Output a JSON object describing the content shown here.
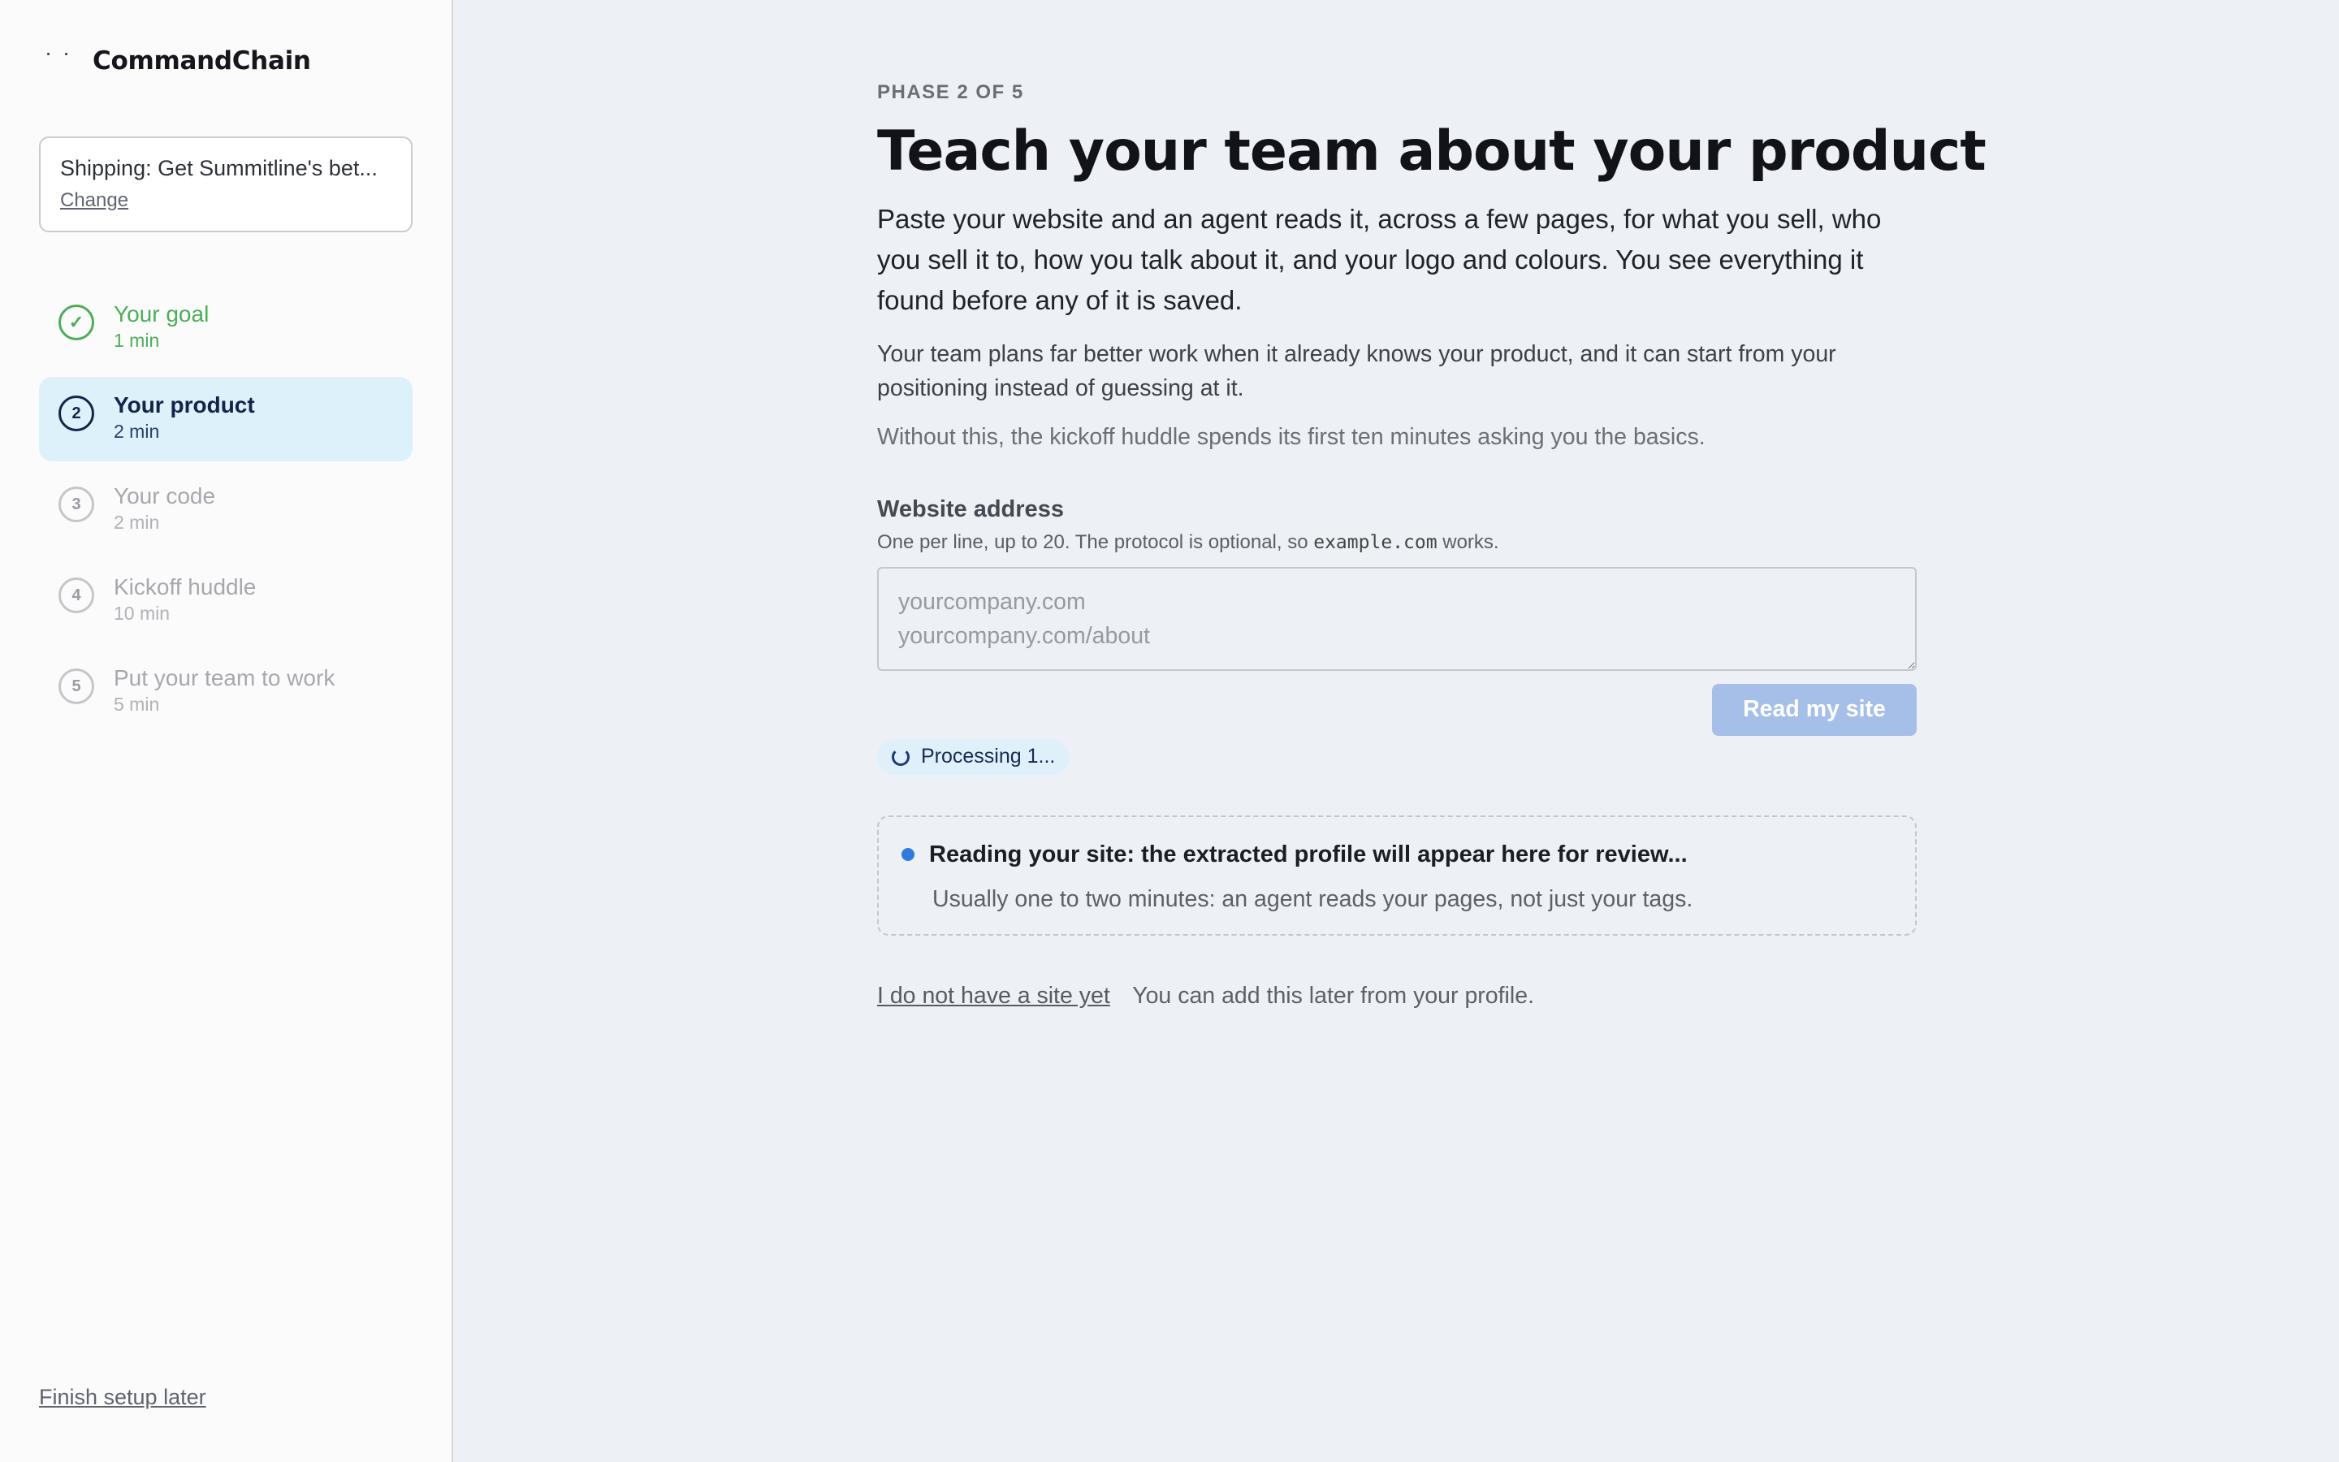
{
  "app": {
    "name": "CommandChain"
  },
  "goal": {
    "text": "Shipping: Get Summitline's bet...",
    "change_label": "Change"
  },
  "steps": [
    {
      "marker": "✓",
      "label": "Your goal",
      "time": "1 min",
      "state": "done"
    },
    {
      "marker": "2",
      "label": "Your product",
      "time": "2 min",
      "state": "active"
    },
    {
      "marker": "3",
      "label": "Your code",
      "time": "2 min",
      "state": "upcoming"
    },
    {
      "marker": "4",
      "label": "Kickoff huddle",
      "time": "10 min",
      "state": "upcoming"
    },
    {
      "marker": "5",
      "label": "Put your team to work",
      "time": "5 min",
      "state": "upcoming"
    }
  ],
  "sidebar": {
    "finish_later": "Finish setup later"
  },
  "main": {
    "phase": "PHASE 2 OF 5",
    "title": "Teach your team about your product",
    "lead": "Paste your website and an agent reads it, across a few pages, for what you sell, who you sell it to, how you talk about it, and your logo and colours. You see everything it found before any of it is saved.",
    "body1": "Your team plans far better work when it already knows your product, and it can start from your positioning instead of guessing at it.",
    "body2": "Without this, the kickoff huddle spends its first ten minutes asking you the basics."
  },
  "website": {
    "label": "Website address",
    "help_before": "One per line, up to 20. The protocol is optional, so ",
    "help_code": "example.com",
    "help_after": " works.",
    "placeholder": "yourcompany.com\nyourcompany.com/about",
    "button": "Read my site"
  },
  "status": {
    "processing": "Processing 1..."
  },
  "review": {
    "title": "Reading your site: the extracted profile will appear here for review...",
    "subtitle": "Usually one to two minutes: an agent reads your pages, not just your tags."
  },
  "no_site": {
    "link": "I do not have a site yet",
    "note": "You can add this later from your profile."
  },
  "colors": {
    "accent": "#2f7be0",
    "done": "#4cae57",
    "active_bg": "#ddf1fa",
    "button_disabled": "#a5bfe8"
  }
}
